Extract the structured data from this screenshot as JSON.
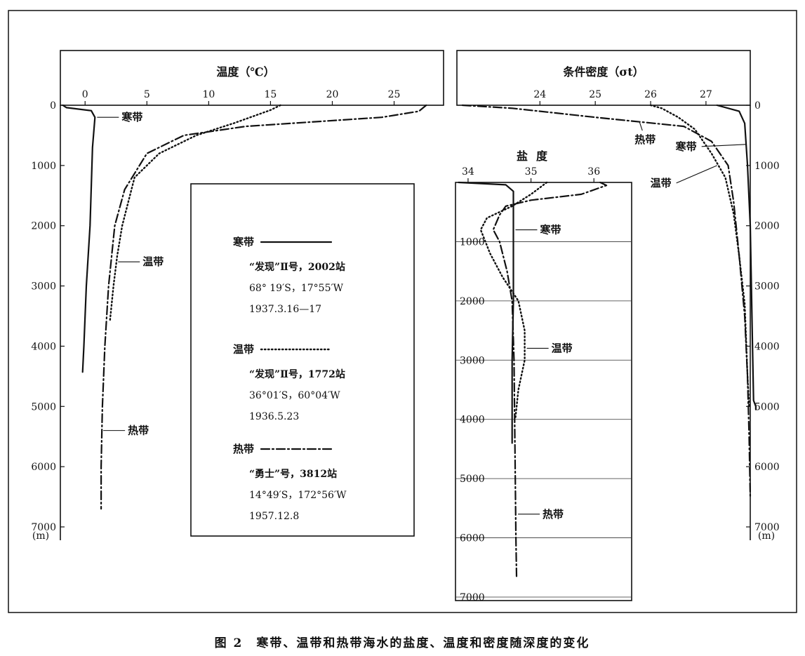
{
  "caption": "图 2　寒带、温带和热带海水的盐度、温度和密度随深度的变化",
  "legend": {
    "entries": [
      {
        "key": "cold",
        "title": "寒带",
        "style": "solid",
        "lines": [
          "“发现”Ⅱ号，2002站",
          "68° 19′S，17°55′W",
          "1937.3.16—17"
        ]
      },
      {
        "key": "temperate",
        "title": "温带",
        "style": "dotted",
        "lines": [
          "“发现”Ⅱ号，1772站",
          "36°01′S，60°04′W",
          "1936.5.23"
        ]
      },
      {
        "key": "tropical",
        "title": "热带",
        "style": "dashdot",
        "lines": [
          "“勇士”号，3812站",
          "14°49′S，172°56′W",
          "1957.12.8"
        ]
      }
    ]
  },
  "chart_data": [
    {
      "type": "line",
      "id": "temperature",
      "title": "温度（℃）",
      "xlabel": "温度（℃）",
      "ylabel": "(m)",
      "xlim": [
        -2,
        29
      ],
      "ylim": [
        0,
        7000
      ],
      "x_ticks": [
        0,
        5,
        10,
        15,
        20,
        25
      ],
      "y_ticks": [
        0,
        1000,
        2000,
        3000,
        4000,
        5000,
        6000,
        7000
      ],
      "series": [
        {
          "name": "寒带",
          "style": "solid",
          "points": [
            [
              -1.8,
              0
            ],
            [
              -1.5,
              40
            ],
            [
              0.5,
              90
            ],
            [
              0.8,
              200
            ],
            [
              0.6,
              700
            ],
            [
              0.4,
              2000
            ],
            [
              0.1,
              3000
            ],
            [
              -0.1,
              4000
            ],
            [
              -0.2,
              4430
            ]
          ]
        },
        {
          "name": "温带",
          "style": "dotted",
          "points": [
            [
              15.8,
              0
            ],
            [
              15,
              80
            ],
            [
              12,
              300
            ],
            [
              9,
              500
            ],
            [
              6,
              800
            ],
            [
              4,
              1200
            ],
            [
              3,
              2000
            ],
            [
              2.6,
              2500
            ],
            [
              2.3,
              3000
            ],
            [
              2,
              3600
            ]
          ]
        },
        {
          "name": "热带",
          "style": "dashdot",
          "points": [
            [
              27.6,
              0
            ],
            [
              27,
              100
            ],
            [
              24,
              200
            ],
            [
              13,
              350
            ],
            [
              8,
              500
            ],
            [
              5,
              800
            ],
            [
              3.2,
              1400
            ],
            [
              2.4,
              2000
            ],
            [
              1.9,
              3000
            ],
            [
              1.6,
              4000
            ],
            [
              1.4,
              5000
            ],
            [
              1.3,
              6000
            ],
            [
              1.3,
              6700
            ]
          ]
        }
      ],
      "annotations": [
        {
          "text": "寒带",
          "series": "寒带",
          "x": 0.8,
          "y": 200
        },
        {
          "text": "温带",
          "series": "温带",
          "x": 2.5,
          "y": 2600
        },
        {
          "text": "热带",
          "series": "热带",
          "x": 1.3,
          "y": 5400
        }
      ]
    },
    {
      "type": "line",
      "id": "density",
      "title": "条件密度（σt）",
      "xlabel": "条件密度（σt）",
      "ylabel": "(m)",
      "xlim": [
        22.5,
        27.8
      ],
      "ylim": [
        0,
        7000
      ],
      "x_ticks": [
        24,
        25,
        26,
        27
      ],
      "y_ticks": [
        0,
        1000,
        2000,
        3000,
        4000,
        5000,
        6000,
        7000
      ],
      "series": [
        {
          "name": "寒带",
          "style": "solid",
          "points": [
            [
              27.2,
              0
            ],
            [
              27.6,
              100
            ],
            [
              27.7,
              300
            ],
            [
              27.75,
              1000
            ],
            [
              27.8,
              2000
            ],
            [
              27.82,
              3000
            ],
            [
              27.84,
              4000
            ],
            [
              27.86,
              4900
            ],
            [
              27.9,
              5000
            ],
            [
              27.9,
              5050
            ]
          ]
        },
        {
          "name": "温带",
          "style": "dotted",
          "points": [
            [
              26.0,
              0
            ],
            [
              26.2,
              50
            ],
            [
              26.5,
              200
            ],
            [
              26.8,
              400
            ],
            [
              27.1,
              800
            ],
            [
              27.35,
              1200
            ],
            [
              27.5,
              1800
            ],
            [
              27.6,
              2500
            ],
            [
              27.7,
              3300
            ],
            [
              27.75,
              4500
            ],
            [
              27.78,
              5000
            ]
          ]
        },
        {
          "name": "热带",
          "style": "dashdot",
          "points": [
            [
              22.6,
              0
            ],
            [
              23.5,
              50
            ],
            [
              25.0,
              200
            ],
            [
              26.6,
              350
            ],
            [
              27.1,
              600
            ],
            [
              27.4,
              1000
            ],
            [
              27.5,
              1600
            ],
            [
              27.6,
              2500
            ],
            [
              27.7,
              3500
            ],
            [
              27.75,
              4500
            ],
            [
              27.78,
              5500
            ],
            [
              27.8,
              6500
            ]
          ]
        }
      ],
      "annotations": [
        {
          "text": "热带",
          "series": "热带",
          "x": 25.8,
          "y": 280
        },
        {
          "text": "寒带",
          "series": "寒带",
          "x": 27.72,
          "y": 650
        },
        {
          "text": "温带",
          "series": "温带",
          "x": 27.2,
          "y": 1000
        }
      ]
    },
    {
      "type": "line",
      "id": "salinity",
      "title": "盐度",
      "xlabel": "盐度",
      "ylabel": "",
      "xlim": [
        33.8,
        36.6
      ],
      "ylim": [
        0,
        7000
      ],
      "x_ticks": [
        34,
        35,
        36
      ],
      "y_ticks": [
        1000,
        2000,
        3000,
        4000,
        5000,
        6000,
        7000
      ],
      "series": [
        {
          "name": "寒带",
          "style": "solid",
          "points": [
            [
              33.85,
              0
            ],
            [
              34.6,
              40
            ],
            [
              34.72,
              150
            ],
            [
              34.72,
              1000
            ],
            [
              34.72,
              2000
            ],
            [
              34.7,
              3000
            ],
            [
              34.7,
              4000
            ],
            [
              34.7,
              4400
            ]
          ]
        },
        {
          "name": "温带",
          "style": "dotted",
          "points": [
            [
              35.25,
              0
            ],
            [
              35.0,
              200
            ],
            [
              34.7,
              400
            ],
            [
              34.3,
              600
            ],
            [
              34.2,
              800
            ],
            [
              34.35,
              1200
            ],
            [
              34.55,
              1600
            ],
            [
              34.8,
              2000
            ],
            [
              34.9,
              2500
            ],
            [
              34.9,
              3000
            ],
            [
              34.8,
              3500
            ],
            [
              34.75,
              4000
            ]
          ]
        },
        {
          "name": "热带",
          "style": "dashdot",
          "points": [
            [
              36.1,
              0
            ],
            [
              36.2,
              50
            ],
            [
              35.8,
              200
            ],
            [
              35.0,
              300
            ],
            [
              34.6,
              400
            ],
            [
              34.5,
              550
            ],
            [
              34.4,
              800
            ],
            [
              34.5,
              1000
            ],
            [
              34.62,
              1500
            ],
            [
              34.7,
              2000
            ],
            [
              34.73,
              3000
            ],
            [
              34.74,
              4000
            ],
            [
              34.75,
              5000
            ],
            [
              34.76,
              6000
            ],
            [
              34.77,
              6650
            ]
          ]
        }
      ],
      "annotations": [
        {
          "text": "寒带",
          "series": "寒带",
          "x": 34.72,
          "y": 800
        },
        {
          "text": "温带",
          "series": "温带",
          "x": 34.9,
          "y": 2800
        },
        {
          "text": "热带",
          "series": "热带",
          "x": 34.76,
          "y": 5600
        }
      ]
    }
  ]
}
